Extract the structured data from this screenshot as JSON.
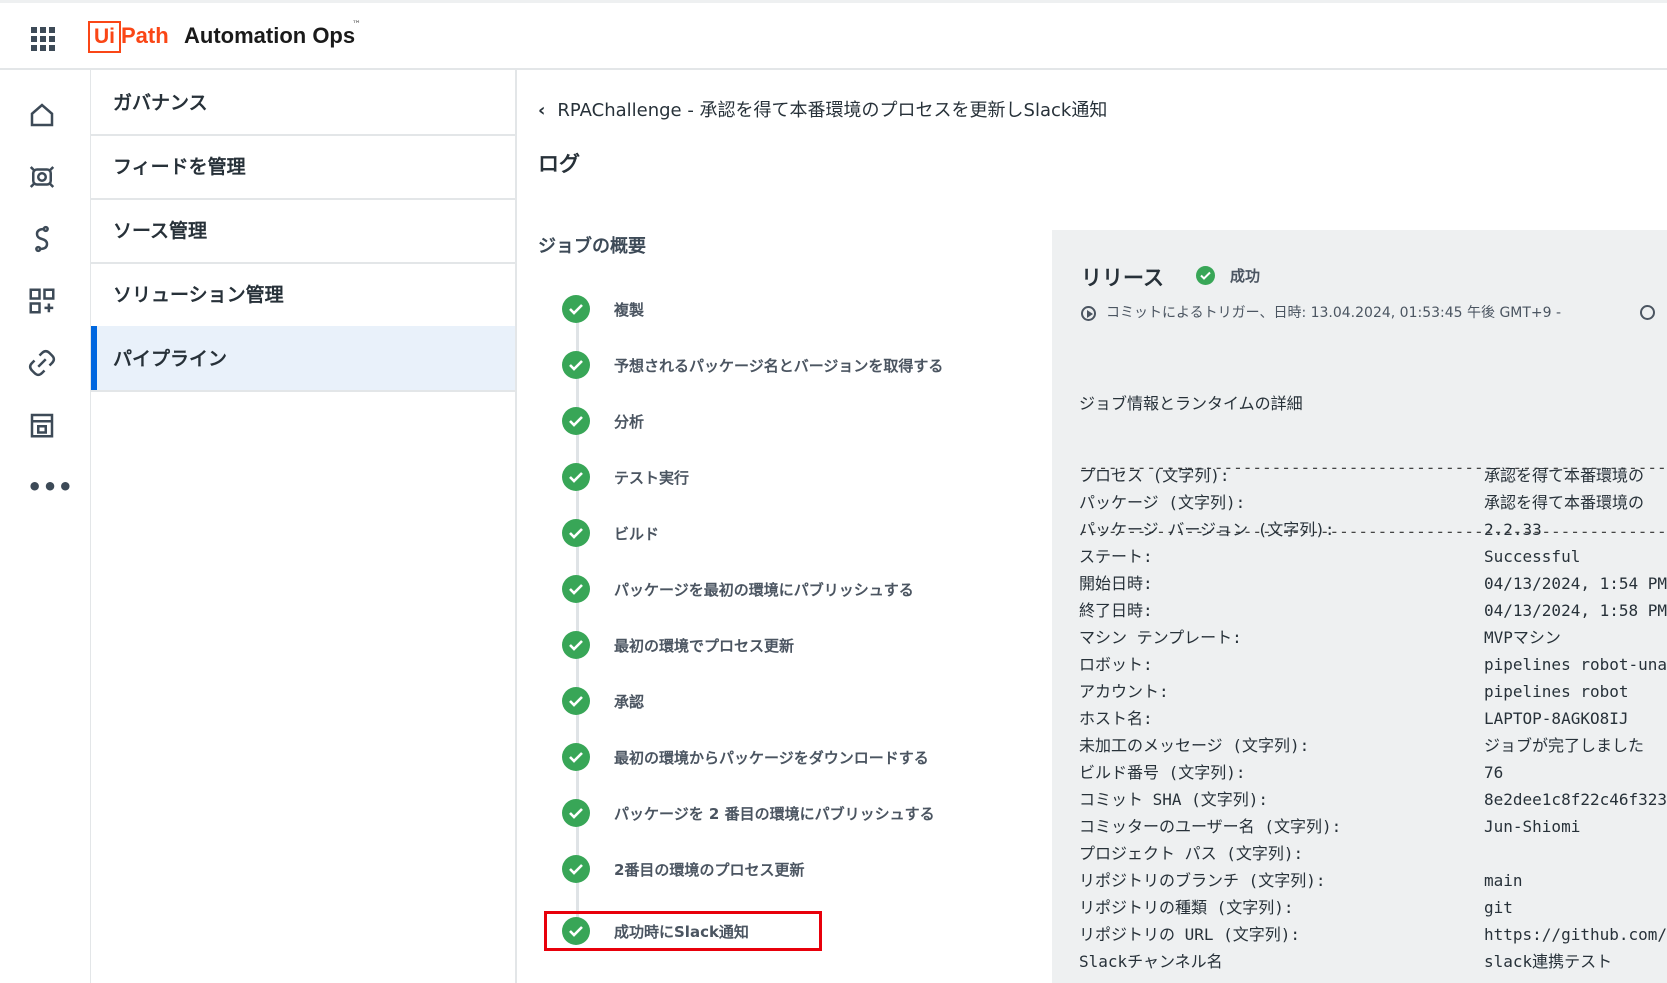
{
  "header": {
    "logo_ui": "Ui",
    "logo_path": "Path",
    "product": "Automation Ops",
    "tm": "™"
  },
  "rail": {
    "icons": [
      "home-icon",
      "sensor-icon",
      "source-icon",
      "dashboard-add-icon",
      "link-icon",
      "building-icon",
      "more-icon"
    ],
    "more": "•••"
  },
  "nav": {
    "items": [
      {
        "label": "ガバナンス"
      },
      {
        "label": "フィードを管理"
      },
      {
        "label": "ソース管理"
      },
      {
        "label": "ソリューション管理"
      },
      {
        "label": "パイプライン"
      }
    ]
  },
  "main": {
    "back_chevron": "‹",
    "back_label": "RPAChallenge - 承認を得て本番環境のプロセスを更新しSlack通知",
    "log_title": "ログ",
    "summary_title": "ジョブの概要",
    "steps": [
      {
        "label": "複製"
      },
      {
        "label": "予想されるパッケージ名とバージョンを取得する"
      },
      {
        "label": "分析"
      },
      {
        "label": "テスト実行"
      },
      {
        "label": "ビルド"
      },
      {
        "label": "パッケージを最初の環境にパブリッシュする"
      },
      {
        "label": "最初の環境でプロセス更新"
      },
      {
        "label": "承認"
      },
      {
        "label": "最初の環境からパッケージをダウンロードする"
      },
      {
        "label": "パッケージを 2 番目の環境にパブリッシュする"
      },
      {
        "label": "2番目の環境のプロセス更新"
      },
      {
        "label": "成功時にSlack通知"
      }
    ]
  },
  "release": {
    "title": "リリース",
    "status": "成功",
    "trigger": "コミットによるトリガー、日時: 13.04.2024, 01:53:45 午後 GMT+9   -",
    "log_heading": "ジョブ情報とランタイムの詳細",
    "dashes": "-------------------------------------------------------------",
    "fields": [
      {
        "k": "プロセス (文字列):",
        "v": "承認を得て本番環境の"
      },
      {
        "k": "パッケージ (文字列):",
        "v": "承認を得て本番環境の"
      },
      {
        "k": "パッケージ バージョン (文字列):",
        "v": "2.2.33"
      },
      {
        "k": "ステート:",
        "v": "Successful"
      },
      {
        "k": "開始日時:",
        "v": "04/13/2024, 1:54 PM"
      },
      {
        "k": "終了日時:",
        "v": "04/13/2024, 1:58 PM"
      },
      {
        "k": "マシン テンプレート:",
        "v": "MVPマシン"
      },
      {
        "k": "ロボット:",
        "v": "pipelines robot-una"
      },
      {
        "k": "アカウント:",
        "v": "pipelines robot"
      },
      {
        "k": "ホスト名:",
        "v": "LAPTOP-8AGKO8IJ"
      },
      {
        "k": "未加工のメッセージ (文字列):",
        "v": "ジョブが完了しました"
      },
      {
        "k": "ビルド番号 (文字列):",
        "v": "76"
      },
      {
        "k": "コミット SHA (文字列):",
        "v": "8e2dee1c8f22c46f323"
      },
      {
        "k": "コミッターのユーザー名 (文字列):",
        "v": "Jun-Shiomi"
      },
      {
        "k": "プロジェクト パス (文字列):",
        "v": ""
      },
      {
        "k": "リポジトリのブランチ (文字列):",
        "v": "main"
      },
      {
        "k": "リポジトリの種類 (文字列):",
        "v": "git"
      },
      {
        "k": "リポジトリの URL (文字列):",
        "v": "https://github.com/"
      },
      {
        "k": "Slackチャンネル名",
        "v": "slack連携テスト"
      }
    ]
  },
  "colors": {
    "brand": "#fa4616",
    "success": "#38a657",
    "active_nav": "#e9f1fa",
    "highlight": "#e8000b"
  }
}
